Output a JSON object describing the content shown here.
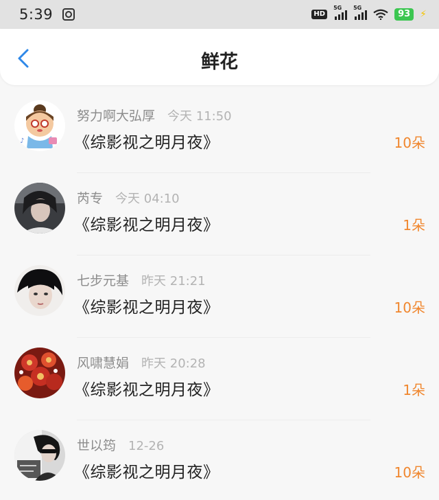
{
  "status_bar": {
    "time": "5:39",
    "network_1": "5G",
    "network_2": "5G",
    "hd_label": "HD",
    "battery": "93"
  },
  "header": {
    "title": "鲜花"
  },
  "items": [
    {
      "username": "努力啊大弘厚",
      "time": "今天 11:50",
      "book": "《综影视之明月夜》",
      "count": "10朵"
    },
    {
      "username": "芮专",
      "time": "今天 04:10",
      "book": "《综影视之明月夜》",
      "count": "1朵"
    },
    {
      "username": "七步元基",
      "time": "昨天 21:21",
      "book": "《综影视之明月夜》",
      "count": "10朵"
    },
    {
      "username": "风啸慧娟",
      "time": "昨天 20:28",
      "book": "《综影视之明月夜》",
      "count": "1朵"
    },
    {
      "username": "世以筠",
      "time": "12-26",
      "book": "《综影视之明月夜》",
      "count": "10朵"
    }
  ],
  "colors": {
    "accent_blue": "#2e88e8",
    "count_orange": "#f0862d",
    "battery_green": "#3cc651"
  }
}
